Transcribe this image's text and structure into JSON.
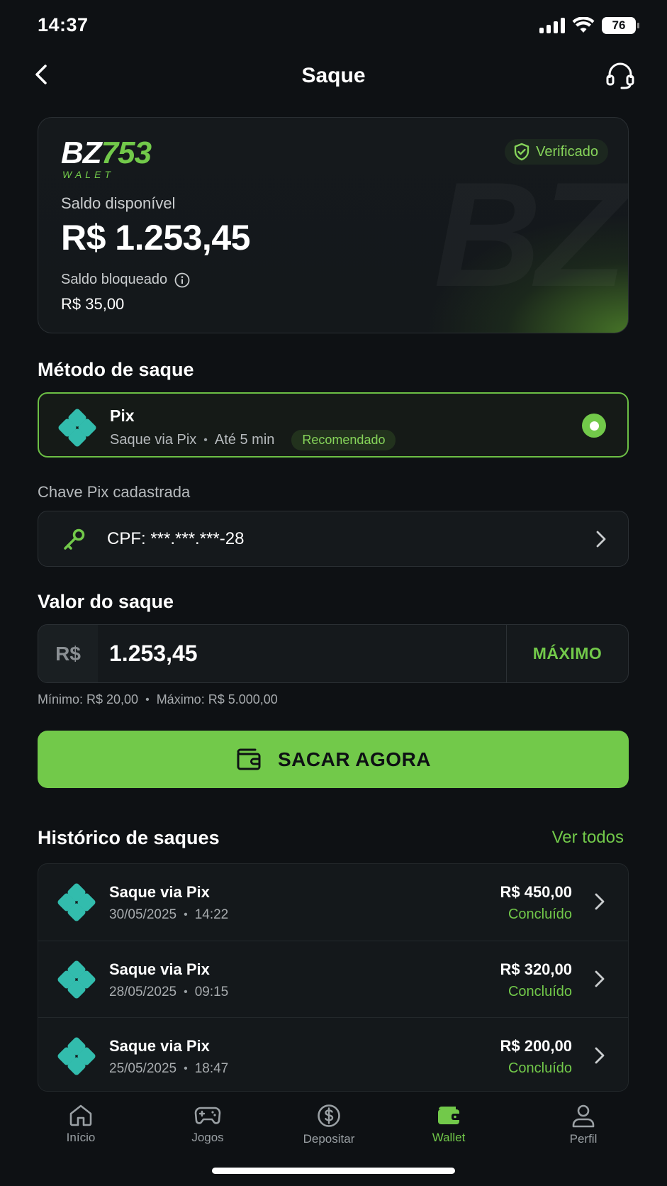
{
  "status_bar": {
    "time": "14:37",
    "battery": "76"
  },
  "header": {
    "title": "Saque"
  },
  "wallet": {
    "logo_main": "BZ",
    "logo_number": "753",
    "logo_sub": "WALET",
    "watermark": "BZ",
    "verified_label": "Verificado",
    "balance_label": "Saldo disponível",
    "balance_value": "R$ 1.253,45",
    "locked_label": "Saldo bloqueado",
    "locked_value": "R$ 35,00"
  },
  "method": {
    "section_title": "Método de saque",
    "name": "Pix",
    "description": "Saque via Pix",
    "time": "Até 5 min",
    "badge": "Recomendado",
    "selected": true
  },
  "pix_key": {
    "label": "Chave Pix cadastrada",
    "value": "CPF: ***.***.***-28"
  },
  "amount": {
    "section_title": "Valor do saque",
    "currency": "R$",
    "value": "1.253,45",
    "max_button": "MÁXIMO",
    "min_text": "Mínimo: R$ 20,00",
    "max_text": "Máximo: R$ 5.000,00"
  },
  "cta": {
    "label": "SACAR AGORA"
  },
  "history": {
    "title": "Histórico de saques",
    "see_all": "Ver todos",
    "items": [
      {
        "title": "Saque via Pix",
        "date": "30/05/2025",
        "time": "14:22",
        "amount": "R$ 450,00",
        "status": "Concluído"
      },
      {
        "title": "Saque via Pix",
        "date": "28/05/2025",
        "time": "09:15",
        "amount": "R$ 320,00",
        "status": "Concluído"
      },
      {
        "title": "Saque via Pix",
        "date": "25/05/2025",
        "time": "18:47",
        "amount": "R$ 200,00",
        "status": "Concluído"
      }
    ]
  },
  "nav": {
    "items": [
      {
        "label": "Início",
        "icon": "home-icon"
      },
      {
        "label": "Jogos",
        "icon": "gamepad-icon"
      },
      {
        "label": "Depositar",
        "icon": "dollar-coin-icon"
      },
      {
        "label": "Wallet",
        "icon": "wallet-icon",
        "active": true
      },
      {
        "label": "Perfil",
        "icon": "user-icon"
      }
    ]
  },
  "colors": {
    "background": "#0e1114",
    "accent": "#72c94a",
    "pix": "#32bcad",
    "card": "#15191c"
  }
}
